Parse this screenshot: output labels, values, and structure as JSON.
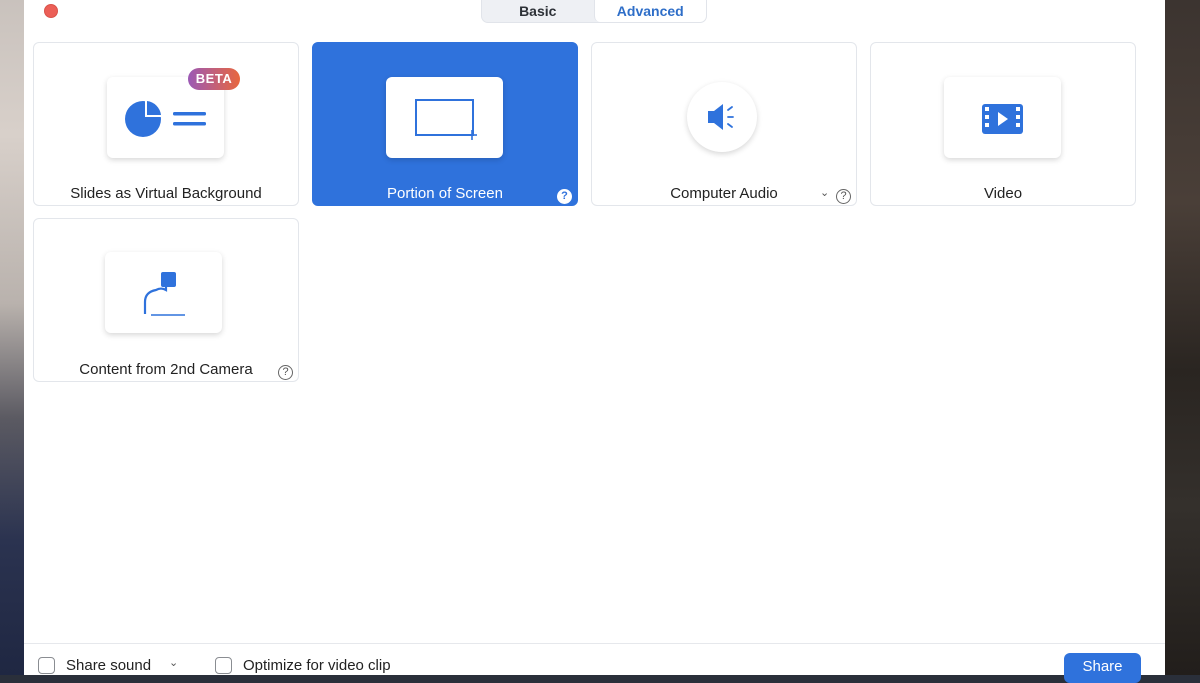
{
  "tabs": [
    {
      "label": "Basic",
      "active": false
    },
    {
      "label": "Advanced",
      "active": true
    }
  ],
  "cards": [
    {
      "label": "Slides as Virtual Background",
      "badge": "BETA",
      "icon": "slides-icon"
    },
    {
      "label": "Portion of Screen",
      "selected": true,
      "icon": "screen-region-icon",
      "help": "?"
    },
    {
      "label": "Computer Audio",
      "icon": "speaker-icon",
      "help": "?",
      "dropdown": "⌄"
    },
    {
      "label": "Video",
      "icon": "film-icon"
    },
    {
      "label": "Content from 2nd Camera",
      "icon": "camera-arm-icon",
      "help": "?"
    }
  ],
  "footer": {
    "share_sound_label": "Share sound",
    "share_sound_dropdown": "⌄",
    "optimize_label": "Optimize for video clip",
    "share_button": "Share"
  },
  "colors": {
    "accent": "#2f72dc",
    "close": "#ec5f57",
    "badge_gradient": [
      "#9b59b6",
      "#e8673e"
    ]
  }
}
